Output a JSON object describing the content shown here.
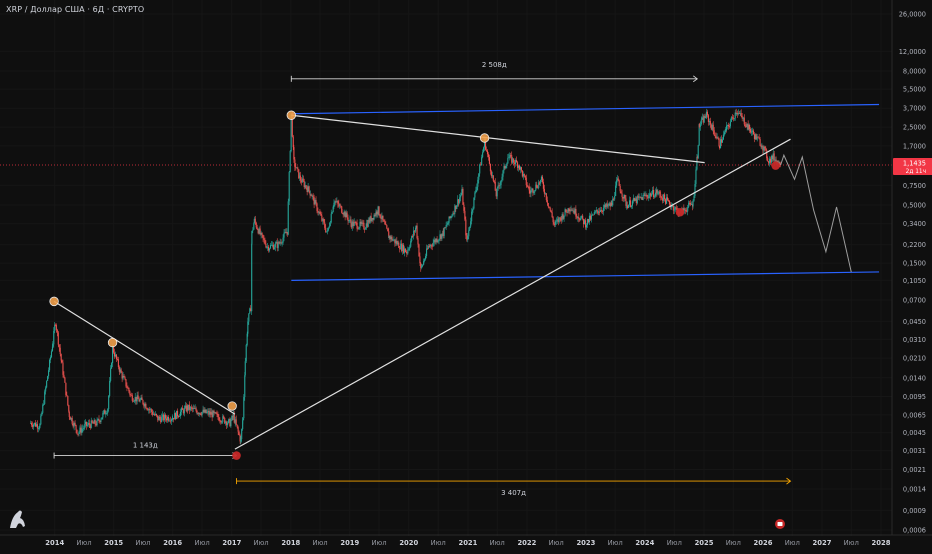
{
  "header": {
    "title": "XRP / Доллар США · 6Д · CRYPTO"
  },
  "colors": {
    "background": "#0f0f0f",
    "up": "#26a69a",
    "down": "#ef5350",
    "channel": "#2962ff",
    "trendline": "#e0e0e0",
    "measure": "#f7a600",
    "pivot_high": "#f0a04b",
    "pivot_low": "#c62828",
    "price_label": "#f23645"
  },
  "price_scale": {
    "current_price": "1,1435",
    "countdown": "2д 11ч"
  },
  "measures": {
    "m1": "1 143д",
    "m2": "2 508д",
    "m3": "3 407д"
  },
  "chart_data": {
    "type": "line",
    "title": "XRP / Доллар США · 6Д · CRYPTO",
    "y_scale": "log",
    "ylim": [
      0.0006,
      26
    ],
    "xlim": [
      "2013-08-01",
      "2028-02-01"
    ],
    "y_ticks": [
      {
        "v": 26,
        "label": "26,0000"
      },
      {
        "v": 12,
        "label": "12,0000"
      },
      {
        "v": 8,
        "label": "8,0000"
      },
      {
        "v": 5.5,
        "label": "5,5000"
      },
      {
        "v": 3.7,
        "label": "3,7000"
      },
      {
        "v": 2.5,
        "label": "2,5000"
      },
      {
        "v": 1.7,
        "label": "1,7000"
      },
      {
        "v": 0.75,
        "label": "0,7500"
      },
      {
        "v": 0.5,
        "label": "0,5000"
      },
      {
        "v": 0.34,
        "label": "0,3400"
      },
      {
        "v": 0.22,
        "label": "0,2200"
      },
      {
        "v": 0.15,
        "label": "0,1500"
      },
      {
        "v": 0.105,
        "label": "0,1050"
      },
      {
        "v": 0.07,
        "label": "0,0700"
      },
      {
        "v": 0.045,
        "label": "0,0450"
      },
      {
        "v": 0.031,
        "label": "0,0310"
      },
      {
        "v": 0.021,
        "label": "0,0210"
      },
      {
        "v": 0.014,
        "label": "0,0140"
      },
      {
        "v": 0.0095,
        "label": "0,0095"
      },
      {
        "v": 0.0065,
        "label": "0,0065"
      },
      {
        "v": 0.0045,
        "label": "0,0045"
      },
      {
        "v": 0.0031,
        "label": "0,0031"
      },
      {
        "v": 0.0021,
        "label": "0,0021"
      },
      {
        "v": 0.0014,
        "label": "0,0014"
      },
      {
        "v": 0.0009,
        "label": "0,0009"
      },
      {
        "v": 0.0006,
        "label": "0,0006"
      }
    ],
    "x_ticks": [
      {
        "d": "2014-01-01",
        "label": "2014",
        "bold": true
      },
      {
        "d": "2014-07-01",
        "label": "Июл",
        "bold": false
      },
      {
        "d": "2015-01-01",
        "label": "2015",
        "bold": true
      },
      {
        "d": "2015-07-01",
        "label": "Июл",
        "bold": false
      },
      {
        "d": "2016-01-01",
        "label": "2016",
        "bold": true
      },
      {
        "d": "2016-07-01",
        "label": "Июл",
        "bold": false
      },
      {
        "d": "2017-01-01",
        "label": "2017",
        "bold": true
      },
      {
        "d": "2017-07-01",
        "label": "Июл",
        "bold": false
      },
      {
        "d": "2018-01-01",
        "label": "2018",
        "bold": true
      },
      {
        "d": "2018-07-01",
        "label": "Июл",
        "bold": false
      },
      {
        "d": "2019-01-01",
        "label": "2019",
        "bold": true
      },
      {
        "d": "2019-07-01",
        "label": "Июл",
        "bold": false
      },
      {
        "d": "2020-01-01",
        "label": "2020",
        "bold": true
      },
      {
        "d": "2020-07-01",
        "label": "Июл",
        "bold": false
      },
      {
        "d": "2021-01-01",
        "label": "2021",
        "bold": true
      },
      {
        "d": "2021-07-01",
        "label": "Июл",
        "bold": false
      },
      {
        "d": "2022-01-01",
        "label": "2022",
        "bold": true
      },
      {
        "d": "2022-07-01",
        "label": "Июл",
        "bold": false
      },
      {
        "d": "2023-01-01",
        "label": "2023",
        "bold": true
      },
      {
        "d": "2023-07-01",
        "label": "Июл",
        "bold": false
      },
      {
        "d": "2024-01-01",
        "label": "2024",
        "bold": true
      },
      {
        "d": "2024-07-01",
        "label": "Июл",
        "bold": false
      },
      {
        "d": "2025-01-01",
        "label": "2025",
        "bold": true
      },
      {
        "d": "2025-07-01",
        "label": "Июл",
        "bold": false
      },
      {
        "d": "2026-01-01",
        "label": "2026",
        "bold": true
      },
      {
        "d": "2026-07-01",
        "label": "Июл",
        "bold": false
      },
      {
        "d": "2027-01-01",
        "label": "2027",
        "bold": true
      },
      {
        "d": "2027-07-01",
        "label": "Июл",
        "bold": false
      },
      {
        "d": "2028-01-01",
        "label": "2028",
        "bold": true
      }
    ],
    "price_path": [
      [
        "2013-08-05",
        0.0055
      ],
      [
        "2013-10-01",
        0.0052
      ],
      [
        "2013-12-20",
        0.029
      ],
      [
        "2014-01-05",
        0.045
      ],
      [
        "2014-02-15",
        0.018
      ],
      [
        "2014-04-01",
        0.0065
      ],
      [
        "2014-05-25",
        0.0045
      ],
      [
        "2014-07-10",
        0.0052
      ],
      [
        "2014-09-20",
        0.0055
      ],
      [
        "2014-11-25",
        0.0075
      ],
      [
        "2014-12-25",
        0.026
      ],
      [
        "2015-02-10",
        0.016
      ],
      [
        "2015-04-20",
        0.0095
      ],
      [
        "2015-07-01",
        0.0085
      ],
      [
        "2015-10-01",
        0.006
      ],
      [
        "2016-01-01",
        0.0062
      ],
      [
        "2016-04-01",
        0.0075
      ],
      [
        "2016-06-01",
        0.007
      ],
      [
        "2016-09-01",
        0.0066
      ],
      [
        "2016-12-20",
        0.0055
      ],
      [
        "2017-01-10",
        0.0063
      ],
      [
        "2017-02-25",
        0.0038
      ],
      [
        "2017-03-10",
        0.006
      ],
      [
        "2017-03-25",
        0.02
      ],
      [
        "2017-04-10",
        0.045
      ],
      [
        "2017-04-28",
        0.06
      ],
      [
        "2017-05-05",
        0.28
      ],
      [
        "2017-05-20",
        0.36
      ],
      [
        "2017-07-01",
        0.26
      ],
      [
        "2017-08-10",
        0.21
      ],
      [
        "2017-10-15",
        0.22
      ],
      [
        "2017-12-10",
        0.29
      ],
      [
        "2018-01-04",
        3.2
      ],
      [
        "2018-01-20",
        1.2
      ],
      [
        "2018-03-01",
        0.85
      ],
      [
        "2018-05-01",
        0.65
      ],
      [
        "2018-08-15",
        0.28
      ],
      [
        "2018-09-25",
        0.55
      ],
      [
        "2018-11-15",
        0.45
      ],
      [
        "2019-01-10",
        0.34
      ],
      [
        "2019-04-01",
        0.32
      ],
      [
        "2019-06-25",
        0.45
      ],
      [
        "2019-09-01",
        0.26
      ],
      [
        "2019-12-20",
        0.19
      ],
      [
        "2020-02-15",
        0.32
      ],
      [
        "2020-03-15",
        0.13
      ],
      [
        "2020-05-01",
        0.21
      ],
      [
        "2020-08-01",
        0.28
      ],
      [
        "2020-11-25",
        0.65
      ],
      [
        "2020-12-25",
        0.23
      ],
      [
        "2021-02-01",
        0.5
      ],
      [
        "2021-04-14",
        1.85
      ],
      [
        "2021-06-25",
        0.62
      ],
      [
        "2021-09-05",
        1.35
      ],
      [
        "2021-11-10",
        1.15
      ],
      [
        "2022-01-20",
        0.65
      ],
      [
        "2022-04-01",
        0.83
      ],
      [
        "2022-06-20",
        0.33
      ],
      [
        "2022-09-25",
        0.48
      ],
      [
        "2022-12-30",
        0.34
      ],
      [
        "2023-03-20",
        0.45
      ],
      [
        "2023-06-10",
        0.5
      ],
      [
        "2023-07-14",
        0.82
      ],
      [
        "2023-09-10",
        0.5
      ],
      [
        "2024-01-01",
        0.6
      ],
      [
        "2024-03-15",
        0.65
      ],
      [
        "2024-06-25",
        0.48
      ],
      [
        "2024-08-05",
        0.42
      ],
      [
        "2024-10-25",
        0.52
      ],
      [
        "2024-11-20",
        1.4
      ],
      [
        "2024-12-03",
        2.6
      ],
      [
        "2025-01-16",
        3.2
      ],
      [
        "2025-04-07",
        1.75
      ],
      [
        "2025-05-20",
        2.4
      ],
      [
        "2025-07-20",
        3.5
      ],
      [
        "2025-09-01",
        2.9
      ],
      [
        "2025-10-10",
        2.4
      ],
      [
        "2025-11-20",
        2.0
      ],
      [
        "2025-12-25",
        1.75
      ],
      [
        "2026-02-05",
        1.25
      ],
      [
        "2026-03-05",
        1.35
      ],
      [
        "2026-04-20",
        1.143
      ]
    ],
    "projection": [
      [
        "2026-05-10",
        1.4
      ],
      [
        "2026-07-15",
        0.85
      ],
      [
        "2026-09-01",
        1.35
      ],
      [
        "2026-11-10",
        0.45
      ],
      [
        "2027-01-25",
        0.19
      ],
      [
        "2027-04-01",
        0.48
      ],
      [
        "2027-07-01",
        0.125
      ]
    ],
    "channel": [
      {
        "from": [
          "2018-01-04",
          3.3
        ],
        "to": [
          "2027-12-20",
          4.0
        ]
      },
      {
        "from": [
          "2018-01-04",
          0.105
        ],
        "to": [
          "2027-12-20",
          0.125
        ]
      }
    ],
    "trendlines": [
      {
        "from": [
          "2013-12-28",
          0.068
        ],
        "to": [
          "2017-01-20",
          0.0066
        ]
      },
      {
        "from": [
          "2018-01-04",
          3.2
        ],
        "to": [
          "2025-01-05",
          1.2
        ]
      },
      {
        "from": [
          "2017-01-20",
          0.0032
        ],
        "to": [
          "2026-06-20",
          1.95
        ]
      }
    ],
    "pivots_high": [
      [
        "2013-12-28",
        0.068
      ],
      [
        "2014-12-25",
        0.029
      ],
      [
        "2017-01-03",
        0.0078
      ],
      [
        "2018-01-04",
        3.2
      ],
      [
        "2021-04-14",
        2.0
      ]
    ],
    "pivots_low": [
      [
        "2017-01-30",
        0.0028
      ],
      [
        "2024-08-05",
        0.43
      ],
      [
        "2026-03-20",
        1.13
      ]
    ],
    "measurements": [
      {
        "from": "2013-12-28",
        "to": "2017-01-30",
        "y": 0.0028,
        "label": "1 143д"
      },
      {
        "from": "2018-01-04",
        "to": "2024-11-20",
        "y": 6.8,
        "label": "2 508д"
      },
      {
        "from": "2017-01-30",
        "to": "2026-06-20",
        "y": 0.00165,
        "label": "3 407д"
      }
    ],
    "current_price": 1.1435
  }
}
